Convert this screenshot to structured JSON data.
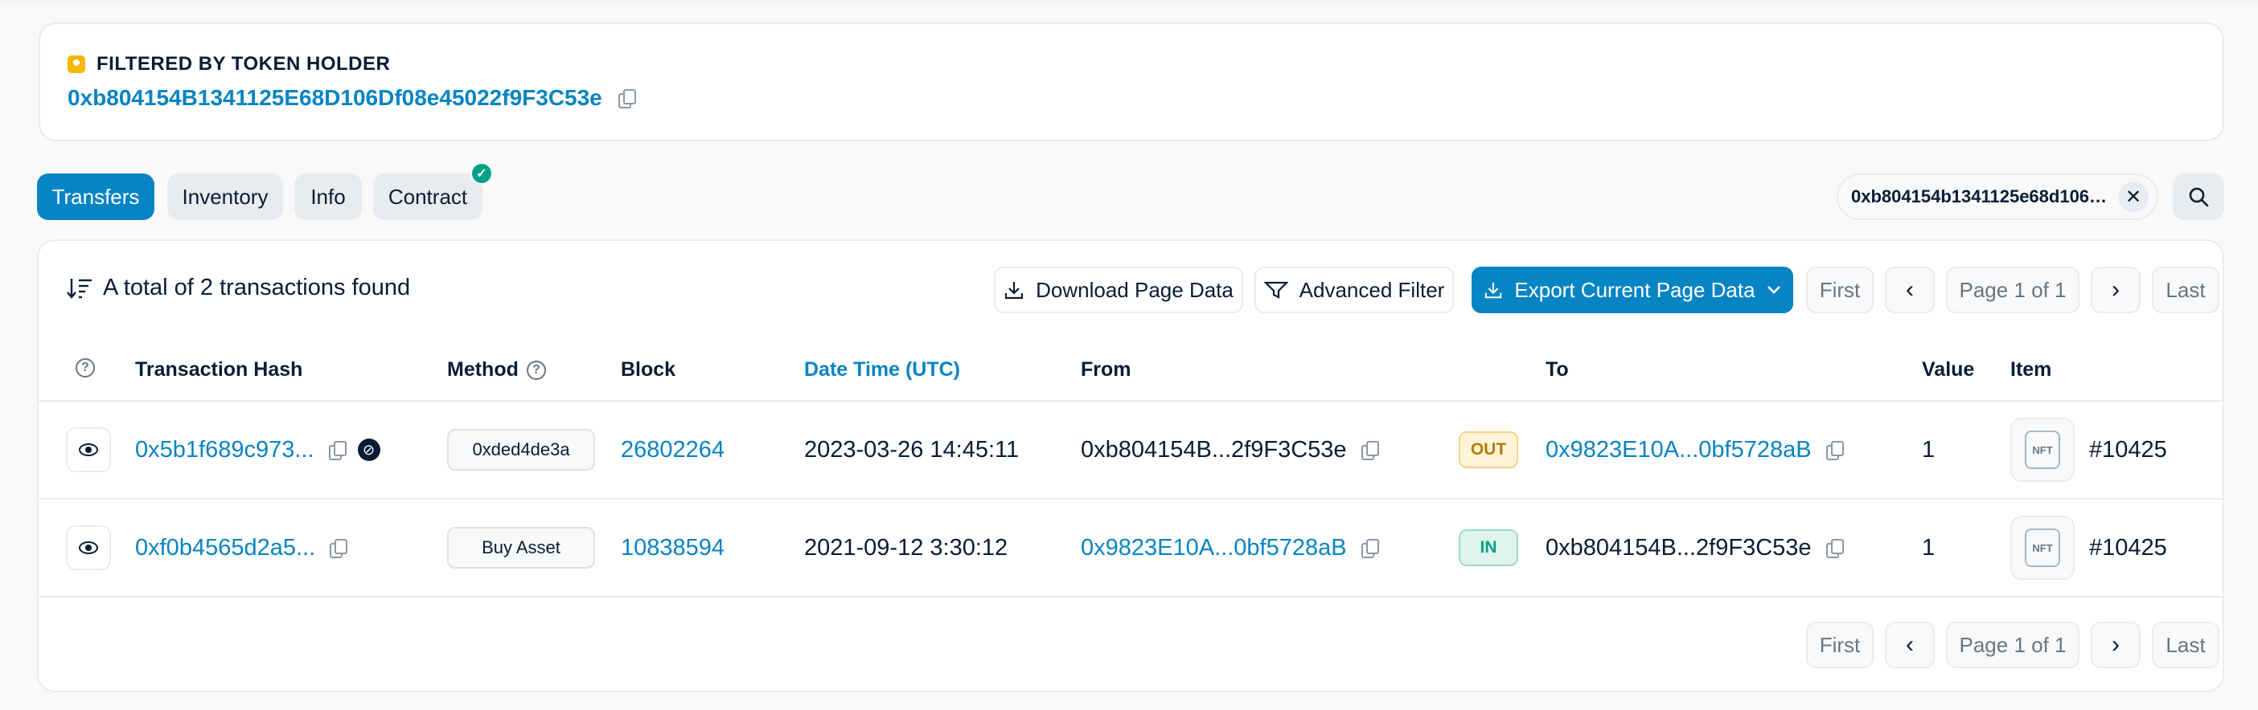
{
  "holder": {
    "title": "FILTERED BY TOKEN HOLDER",
    "address": "0xb804154B1341125E68D106Df08e45022f9F3C53e"
  },
  "tabs": {
    "transfers": "Transfers",
    "inventory": "Inventory",
    "info": "Info",
    "contract": "Contract"
  },
  "search": {
    "value": "0xb804154b1341125e68d106…",
    "clear": "✕"
  },
  "summary": "A total of 2 transactions found",
  "actions": {
    "download": "Download Page Data",
    "advanced_filter": "Advanced Filter",
    "export": "Export Current Page Data"
  },
  "pagination": {
    "first": "First",
    "prev": "‹",
    "page": "Page 1 of 1",
    "next": "›",
    "last": "Last"
  },
  "columns": {
    "hash": "Transaction Hash",
    "method": "Method",
    "block": "Block",
    "datetime": "Date Time (UTC)",
    "from": "From",
    "to": "To",
    "value": "Value",
    "item": "Item"
  },
  "rows": [
    {
      "hash": "0x5b1f689c973...",
      "method": "0xded4de3a",
      "block": "26802264",
      "datetime": "2023-03-26 14:45:11",
      "from": "0xb804154B...2f9F3C53e",
      "direction": "OUT",
      "to": "0x9823E10A...0bf5728aB",
      "value": "1",
      "item": "#10425"
    },
    {
      "hash": "0xf0b4565d2a5...",
      "method": "Buy Asset",
      "block": "10838594",
      "datetime": "2021-09-12 3:30:12",
      "from": "0x9823E10A...0bf5728aB",
      "direction": "IN",
      "to": "0xb804154B...2f9F3C53e",
      "value": "1",
      "item": "#10425"
    }
  ],
  "nft_label": "NFT",
  "colors": {
    "accent": "#0784c3",
    "out_badge": "#b47d00",
    "in_badge": "#00a186"
  }
}
